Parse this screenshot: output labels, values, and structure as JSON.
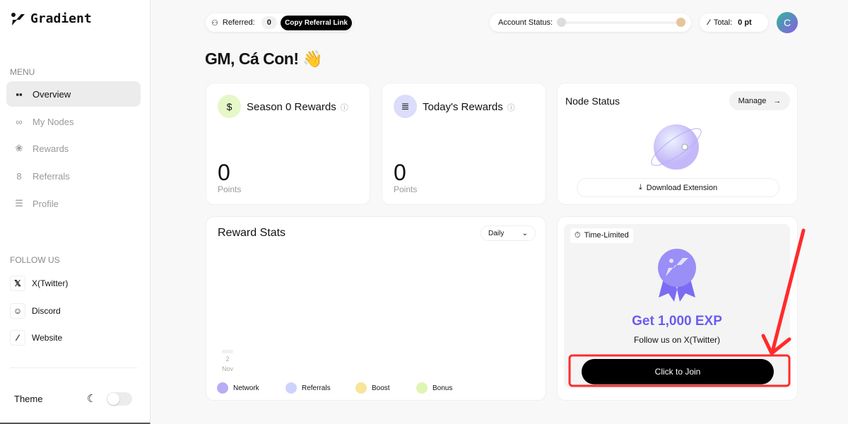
{
  "app": {
    "name": "Gradient"
  },
  "sidebar": {
    "menu_label": "MENU",
    "items": [
      {
        "label": "Overview",
        "icon": "grid-icon",
        "active": true
      },
      {
        "label": "My Nodes",
        "icon": "nodes-icon"
      },
      {
        "label": "Rewards",
        "icon": "award-icon"
      },
      {
        "label": "Referrals",
        "icon": "users-icon"
      },
      {
        "label": "Profile",
        "icon": "sliders-icon"
      }
    ],
    "follow_label": "FOLLOW US",
    "social": [
      {
        "label": "X(Twitter)",
        "icon": "x-icon"
      },
      {
        "label": "Discord",
        "icon": "discord-icon"
      },
      {
        "label": "Website",
        "icon": "gradient-logo-icon"
      }
    ],
    "theme_label": "Theme",
    "dark_mode": false
  },
  "header": {
    "referred_label": "Referred:",
    "referred_count": "0",
    "copy_link": "Copy Referral Link",
    "account_status_label": "Account Status:",
    "account_status_progress": 0,
    "total_label": "Total:",
    "total_value": "0 pt",
    "avatar_initial": "C"
  },
  "greeting": "GM, Cá Con! 👋",
  "cards": {
    "season": {
      "title": "Season 0 Rewards",
      "value": "0",
      "unit": "Points"
    },
    "today": {
      "title": "Today's Rewards",
      "value": "0",
      "unit": "Points"
    },
    "node": {
      "title": "Node Status",
      "manage": "Manage",
      "download": "Download Extension"
    }
  },
  "reward_stats": {
    "title": "Reward Stats",
    "period": "Daily"
  },
  "chart_data": {
    "type": "bar",
    "categories": [
      "2 Nov"
    ],
    "tick_day": "2",
    "tick_month": "Nov",
    "series": [
      {
        "name": "Network",
        "values": [
          0
        ],
        "color": "#b7adf7"
      },
      {
        "name": "Referrals",
        "values": [
          0
        ],
        "color": "#ced3fd"
      },
      {
        "name": "Boost",
        "values": [
          0
        ],
        "color": "#f7e59a"
      },
      {
        "name": "Bonus",
        "values": [
          0
        ],
        "color": "#def5b4"
      }
    ],
    "legend": "bottom"
  },
  "promo": {
    "badge": "Time-Limited",
    "headline": "Get 1,000 EXP",
    "sub": "Follow us on X(Twitter)",
    "button": "Click to Join",
    "accent": "#6b5cf0"
  },
  "colors": {
    "annotation": "#ff2b2b"
  }
}
